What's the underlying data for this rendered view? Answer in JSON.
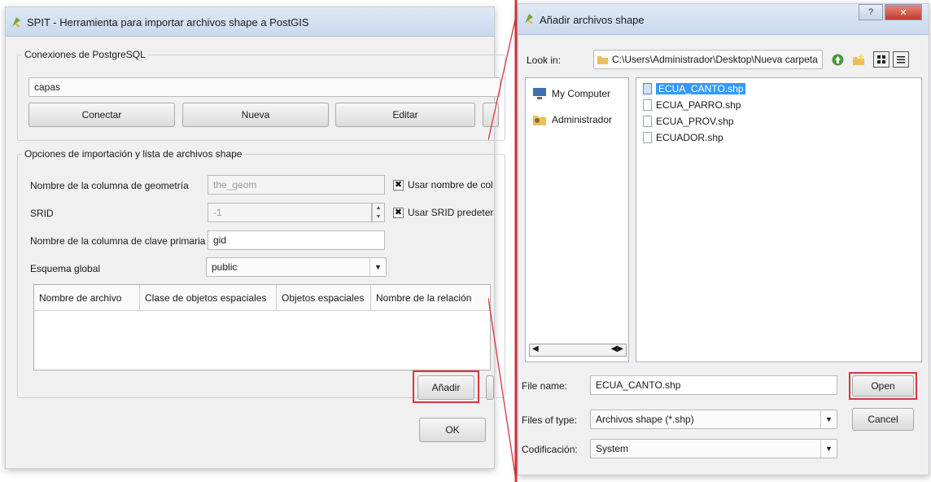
{
  "left_window": {
    "title": "SPIT - Herramienta para importar archivos shape a PostGIS",
    "connections_group": {
      "legend": "Conexiones de PostgreSQL",
      "selected_connection": "capas",
      "buttons": {
        "connect": "Conectar",
        "new": "Nueva",
        "edit": "Editar"
      }
    },
    "options_group": {
      "legend": "Opciones de importación y lista de archivos shape",
      "geom_column_label": "Nombre de la columna de geometría",
      "geom_column_value": "the_geom",
      "use_default_geom_label": "Usar nombre de col",
      "srid_label": "SRID",
      "srid_value": "-1",
      "use_default_srid_label": "Usar SRID predeter",
      "pk_label": "Nombre de la columna de clave primaria",
      "pk_value": "gid",
      "schema_label": "Esquema global",
      "schema_value": "public",
      "table_headers": [
        "Nombre de archivo",
        "Clase de objetos espaciales",
        "Objetos espaciales",
        "Nombre de la relación"
      ],
      "add_button": "Añadir"
    },
    "ok_button": "OK"
  },
  "right_window": {
    "title": "Añadir archivos shape",
    "look_in_label": "Look in:",
    "look_in_path": "C:\\Users\\Administrador\\Desktop\\Nueva carpeta",
    "places": [
      "My Computer",
      "Administrador"
    ],
    "files": [
      "ECUA_CANTO.shp",
      "ECUA_PARRO.shp",
      "ECUA_PROV.shp",
      "ECUADOR.shp"
    ],
    "selected_file": "ECUA_CANTO.shp",
    "file_name_label": "File name:",
    "file_name_value": "ECUA_CANTO.shp",
    "open_button": "Open",
    "files_of_type_label": "Files of type:",
    "files_of_type_value": "Archivos shape (*.shp)",
    "cancel_button": "Cancel",
    "encoding_label": "Codificación:",
    "encoding_value": "System"
  },
  "colors": {
    "highlight_red": "#d9363e",
    "selection_blue": "#3399ff",
    "window_bg": "#f0f0f0"
  },
  "icons": [
    "qgis-logo-icon",
    "dropdown-arrow-icon",
    "up-folder-icon",
    "new-folder-icon",
    "list-view-icon",
    "detail-view-icon",
    "computer-icon",
    "user-folder-icon",
    "file-icon",
    "close-icon",
    "help-icon"
  ]
}
